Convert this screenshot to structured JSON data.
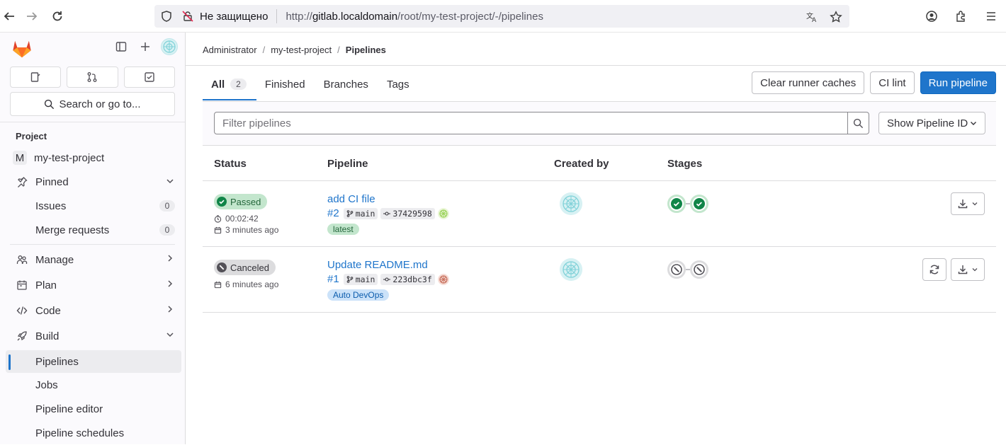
{
  "browser": {
    "security_label": "Не защищено",
    "url_prefix": "http://",
    "url_host": "gitlab.localdomain",
    "url_path": "/root/my-test-project/-/pipelines"
  },
  "sidebar": {
    "search_label": "Search or go to...",
    "section_label": "Project",
    "project_letter": "M",
    "project_name": "my-test-project",
    "pinned_label": "Pinned",
    "pinned_items": [
      {
        "label": "Issues",
        "count": "0"
      },
      {
        "label": "Merge requests",
        "count": "0"
      }
    ],
    "groups": [
      {
        "label": "Manage"
      },
      {
        "label": "Plan"
      },
      {
        "label": "Code"
      },
      {
        "label": "Build"
      }
    ],
    "build_items": [
      {
        "label": "Pipelines"
      },
      {
        "label": "Jobs"
      },
      {
        "label": "Pipeline editor"
      },
      {
        "label": "Pipeline schedules"
      }
    ]
  },
  "breadcrumb": [
    "Administrator",
    "my-test-project",
    "Pipelines"
  ],
  "tabs": [
    {
      "label": "All",
      "count": "2"
    },
    {
      "label": "Finished"
    },
    {
      "label": "Branches"
    },
    {
      "label": "Tags"
    }
  ],
  "actions": {
    "clear_cache": "Clear runner caches",
    "ci_lint": "CI lint",
    "run_pipeline": "Run pipeline"
  },
  "filter": {
    "placeholder": "Filter pipelines",
    "dropdown_label": "Show Pipeline ID"
  },
  "table": {
    "headers": [
      "Status",
      "Pipeline",
      "Created by",
      "Stages"
    ],
    "rows": [
      {
        "status": "Passed",
        "duration": "00:02:42",
        "finished": "3 minutes ago",
        "title": "add CI file",
        "id": "#2",
        "branch": "main",
        "commit": "37429598",
        "tag": "latest",
        "stages": [
          "success",
          "success"
        ]
      },
      {
        "status": "Canceled",
        "duration": "",
        "finished": "6 minutes ago",
        "title": "Update README.md",
        "id": "#1",
        "branch": "main",
        "commit": "223dbc3f",
        "tag": "Auto DevOps",
        "stages": [
          "canceled",
          "canceled"
        ]
      }
    ]
  },
  "colors": {
    "accent": "#1f75cb",
    "success": "#108548",
    "canceled": "#535158"
  }
}
